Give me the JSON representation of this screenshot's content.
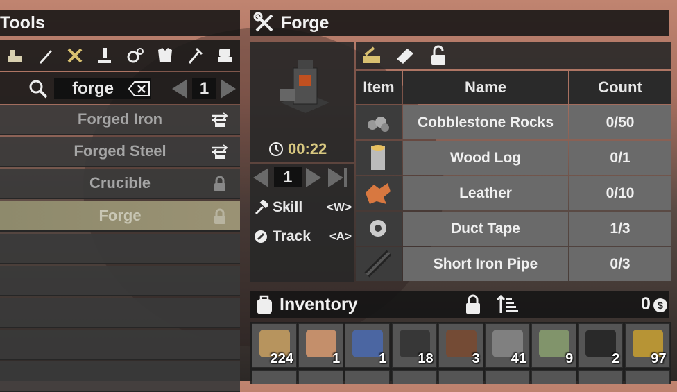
{
  "tools": {
    "title": "Tools",
    "categories": [
      "building-icon",
      "weapon-icon",
      "tools-icon",
      "science-icon",
      "gears-icon",
      "armor-icon",
      "food-icon",
      "furniture-icon"
    ],
    "search_value": "forge",
    "quantity": "1",
    "recipes": [
      {
        "label": "Forged Iron",
        "icon": "anvil-icon",
        "selected": false
      },
      {
        "label": "Forged Steel",
        "icon": "anvil-icon",
        "selected": false
      },
      {
        "label": "Crucible",
        "icon": "lock-icon",
        "selected": false
      },
      {
        "label": "Forge",
        "icon": "lock-icon",
        "selected": true
      }
    ]
  },
  "forge": {
    "title": "Forge",
    "craft_time": "00:22",
    "craft_quantity": "1",
    "skill_label": "Skill",
    "skill_key": "<W>",
    "track_label": "Track",
    "track_key": "<A>",
    "tabs": [
      "ingredients-icon",
      "book-icon",
      "unlock-icon"
    ],
    "columns": {
      "item": "Item",
      "name": "Name",
      "count": "Count"
    },
    "ingredients": [
      {
        "name": "Cobblestone Rocks",
        "count": "0/50",
        "icon": "rocks-icon"
      },
      {
        "name": "Wood Log",
        "count": "0/1",
        "icon": "log-icon"
      },
      {
        "name": "Leather",
        "count": "0/10",
        "icon": "leather-icon"
      },
      {
        "name": "Duct Tape",
        "count": "1/3",
        "icon": "tape-icon"
      },
      {
        "name": "Short Iron Pipe",
        "count": "0/3",
        "icon": "pipe-icon"
      }
    ]
  },
  "inventory": {
    "title": "Inventory",
    "currency": "0",
    "slots": [
      {
        "qty": "224",
        "icon": "planks-icon",
        "color": "#c9a060"
      },
      {
        "qty": "1",
        "icon": "shrimp-icon",
        "color": "#d89a70"
      },
      {
        "qty": "1",
        "icon": "magazine-icon",
        "color": "#4a6ab0"
      },
      {
        "qty": "18",
        "icon": "coal-icon",
        "color": "#333333"
      },
      {
        "qty": "3",
        "icon": "dirt-icon",
        "color": "#7a4a30"
      },
      {
        "qty": "41",
        "icon": "nails-icon",
        "color": "#888888"
      },
      {
        "qty": "9",
        "icon": "cash-icon",
        "color": "#8aa070"
      },
      {
        "qty": "2",
        "icon": "battery-icon",
        "color": "#222222"
      },
      {
        "qty": "97",
        "icon": "trophy-icon",
        "color": "#c9a030"
      }
    ]
  }
}
